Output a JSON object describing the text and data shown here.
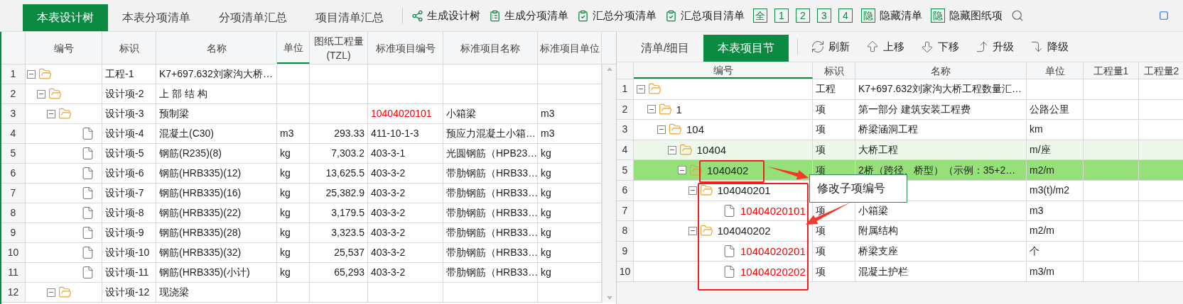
{
  "toolbar": {
    "tabs": [
      {
        "label": "本表设计树",
        "selected": true
      },
      {
        "label": "本表分项清单",
        "selected": false
      },
      {
        "label": "分项清单汇总",
        "selected": false
      },
      {
        "label": "项目清单汇总",
        "selected": false
      }
    ],
    "actions": [
      {
        "kind": "tree",
        "label": "生成设计树"
      },
      {
        "kind": "list",
        "label": "生成分项清单"
      },
      {
        "kind": "check",
        "label": "汇总分项清单"
      },
      {
        "kind": "check",
        "label": "汇总项目清单"
      }
    ],
    "levels": [
      "全",
      "1",
      "2",
      "3",
      "4"
    ],
    "hide_buttons": [
      {
        "glyph": "隐",
        "label": "隐藏清单"
      },
      {
        "glyph": "隐",
        "label": "隐藏图纸项"
      }
    ]
  },
  "design_tree": {
    "columns": [
      {
        "label": "编号",
        "current": false
      },
      {
        "label": "标识",
        "current": false
      },
      {
        "label": "名称",
        "current": false
      },
      {
        "label": "单位",
        "current": true
      },
      {
        "label": "图纸工程量",
        "sublabel": "(TZL)",
        "current": false
      },
      {
        "label": "标准项目编号",
        "current": false
      },
      {
        "label": "标准项目名称",
        "current": false
      },
      {
        "label": "标准项目单位",
        "current": false
      }
    ],
    "rows": [
      {
        "row": "1",
        "kind": "folder",
        "expanded": true,
        "tag": "工程-1",
        "name": "K7+697.632刘家沟大桥…",
        "children": [
          {
            "row": "2",
            "kind": "folder",
            "expanded": true,
            "tag": "设计项-2",
            "name": "上 部 结 构",
            "children": [
              {
                "row": "3",
                "kind": "folder",
                "expanded": true,
                "tag": "设计项-3",
                "name": "预制梁",
                "std_code": "10404020101",
                "std_name": "小箱梁",
                "std_unit": "m3",
                "std_flagged": true,
                "children": [
                  {
                    "row": "4",
                    "kind": "file",
                    "tag": "设计项-4",
                    "name": "混凝土(C30)",
                    "unit": "m3",
                    "qty": "293.33",
                    "std_code": "411-10-1-3",
                    "std_name": "预应力混凝土小箱…",
                    "std_unit": "m3",
                    "std_flagged": false
                  },
                  {
                    "row": "5",
                    "kind": "file",
                    "tag": "设计项-5",
                    "name": "钢筋(R235)(8)",
                    "unit": "kg",
                    "qty": "7,303.2",
                    "std_code": "403-3-1",
                    "std_name": "光圆钢筋（HPB23…",
                    "std_unit": "kg",
                    "std_flagged": false
                  },
                  {
                    "row": "6",
                    "kind": "file",
                    "tag": "设计项-6",
                    "name": "钢筋(HRB335)(12)",
                    "unit": "kg",
                    "qty": "13,625.5",
                    "std_code": "403-3-2",
                    "std_name": "带肋钢筋（HRB33…",
                    "std_unit": "kg",
                    "std_flagged": false
                  },
                  {
                    "row": "7",
                    "kind": "file",
                    "tag": "设计项-7",
                    "name": "钢筋(HRB335)(16)",
                    "unit": "kg",
                    "qty": "25,382.9",
                    "std_code": "403-3-2",
                    "std_name": "带肋钢筋（HRB33…",
                    "std_unit": "kg",
                    "std_flagged": false
                  },
                  {
                    "row": "8",
                    "kind": "file",
                    "tag": "设计项-8",
                    "name": "钢筋(HRB335)(22)",
                    "unit": "kg",
                    "qty": "3,179.5",
                    "std_code": "403-3-2",
                    "std_name": "带肋钢筋（HRB33…",
                    "std_unit": "kg",
                    "std_flagged": false
                  },
                  {
                    "row": "9",
                    "kind": "file",
                    "tag": "设计项-9",
                    "name": "钢筋(HRB335)(28)",
                    "unit": "kg",
                    "qty": "3,323.5",
                    "std_code": "403-3-2",
                    "std_name": "带肋钢筋（HRB33…",
                    "std_unit": "kg",
                    "std_flagged": false
                  },
                  {
                    "row": "10",
                    "kind": "file",
                    "tag": "设计项-10",
                    "name": "钢筋(HRB335)(32)",
                    "unit": "kg",
                    "qty": "25,537",
                    "std_code": "403-3-2",
                    "std_name": "带肋钢筋（HRB33…",
                    "std_unit": "kg",
                    "std_flagged": false
                  },
                  {
                    "row": "11",
                    "kind": "file",
                    "tag": "设计项-11",
                    "name": "钢筋(HRB335)(小计)",
                    "unit": "kg",
                    "qty": "65,293",
                    "std_code": "403-3-2",
                    "std_name": "带肋钢筋（HRB33…",
                    "std_unit": "kg",
                    "std_flagged": false
                  }
                ]
              },
              {
                "row": "12",
                "kind": "folder",
                "expanded": true,
                "tag": "设计项-12",
                "name": "现浇梁"
              }
            ]
          }
        ]
      }
    ]
  },
  "project_section": {
    "tabs": [
      {
        "label": "清单/细目",
        "selected": false
      },
      {
        "label": "本表项目节",
        "selected": true
      }
    ],
    "actions": [
      {
        "kind": "refresh",
        "label": "刷新"
      },
      {
        "kind": "up",
        "label": "上移"
      },
      {
        "kind": "down",
        "label": "下移"
      },
      {
        "kind": "promote",
        "label": "升级"
      },
      {
        "kind": "demote",
        "label": "降级"
      }
    ],
    "columns": [
      {
        "label": "编号",
        "current": true
      },
      {
        "label": "标识",
        "current": false
      },
      {
        "label": "名称",
        "current": false
      },
      {
        "label": "单位",
        "current": false
      },
      {
        "label": "工程量1",
        "current": false
      },
      {
        "label": "工程量2",
        "current": false
      }
    ],
    "rows": [
      {
        "row": "1",
        "kind": "folder",
        "expanded": true,
        "tag": "工程",
        "name": "K7+697.632刘家沟大桥工程数量汇…",
        "selected": false,
        "shaded": false,
        "children": [
          {
            "row": "2",
            "kind": "folder",
            "expanded": true,
            "code": "1",
            "tag": "项",
            "name": "第一部分 建筑安装工程费",
            "unit": "公路公里",
            "selected": false,
            "shaded": false,
            "flagged": false,
            "children": [
              {
                "row": "3",
                "kind": "folder",
                "expanded": true,
                "code": "104",
                "tag": "项",
                "name": "桥梁涵洞工程",
                "unit": "km",
                "selected": false,
                "shaded": false,
                "flagged": false,
                "children": [
                  {
                    "row": "4",
                    "kind": "folder",
                    "expanded": true,
                    "code": "10404",
                    "tag": "项",
                    "name": "大桥工程",
                    "unit": "m/座",
                    "selected": false,
                    "shaded": true,
                    "flagged": false,
                    "children": [
                      {
                        "row": "5",
                        "kind": "folder",
                        "expanded": true,
                        "code": "1040402",
                        "tag": "项",
                        "name": "2桥（跨径、桥型）（示例：35+2…",
                        "unit": "m2/m",
                        "selected": true,
                        "shaded": false,
                        "flagged": false,
                        "children": [
                          {
                            "row": "6",
                            "kind": "folder",
                            "expanded": true,
                            "code": "104040201",
                            "unit": "m3(t)/m2",
                            "selected": false,
                            "shaded": false,
                            "flagged": false,
                            "children": [
                              {
                                "row": "7",
                                "kind": "file",
                                "code": "10404020101",
                                "tag": "项",
                                "name": "小箱梁",
                                "unit": "m3",
                                "selected": false,
                                "shaded": false,
                                "flagged": true
                              }
                            ]
                          },
                          {
                            "row": "8",
                            "kind": "folder",
                            "expanded": true,
                            "code": "104040202",
                            "tag": "项",
                            "name": "附属结构",
                            "unit": "m2/m",
                            "selected": false,
                            "shaded": false,
                            "flagged": false,
                            "children": [
                              {
                                "row": "9",
                                "kind": "file",
                                "code": "10404020201",
                                "tag": "项",
                                "name": "桥梁支座",
                                "unit": "个",
                                "selected": false,
                                "shaded": false,
                                "flagged": true
                              },
                              {
                                "row": "10",
                                "kind": "file",
                                "code": "10404020202",
                                "tag": "项",
                                "name": "混凝土护栏",
                                "unit": "m3/m",
                                "selected": false,
                                "shaded": false,
                                "flagged": true
                              }
                            ]
                          }
                        ]
                      }
                    ]
                  }
                ]
              }
            ]
          }
        ]
      }
    ]
  },
  "annotation": {
    "callout": "修改子项编号"
  }
}
